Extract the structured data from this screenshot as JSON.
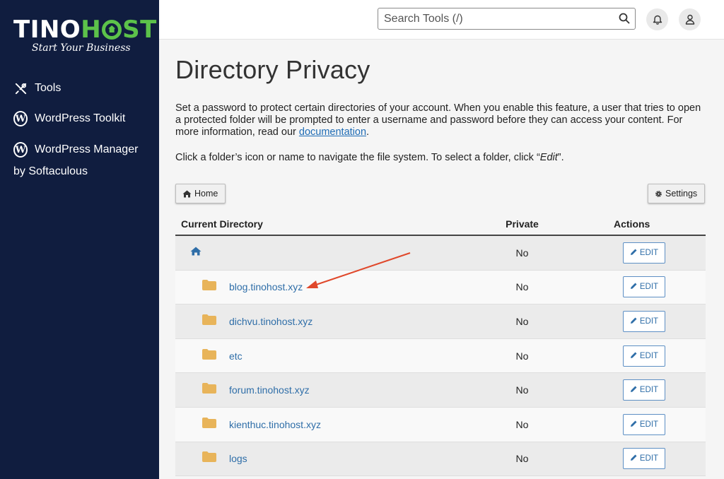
{
  "brand": {
    "logo_text_1": "TINO",
    "logo_text_2": "HOST",
    "tagline": "Start Your Business",
    "accent_green": "#5cc24a",
    "sidebar_bg": "#101d3f"
  },
  "sidebar": {
    "items": [
      {
        "label": "Tools",
        "icon": "tools-icon"
      },
      {
        "label": "WordPress Toolkit",
        "icon": "wordpress-icon"
      },
      {
        "label": "WordPress Manager",
        "icon": "wordpress-icon"
      }
    ],
    "wp_manager_sub": "by Softaculous"
  },
  "topbar": {
    "search_placeholder": "Search Tools (/)",
    "icons": [
      "search-icon",
      "bell-icon",
      "user-icon"
    ]
  },
  "page": {
    "title": "Directory Privacy",
    "desc_part1": "Set a password to protect certain directories of your account. When you enable this feature, a user that tries to open a protected folder will be prompted to enter a username and password before they can access your content. For more information, read our ",
    "desc_link": "documentation",
    "desc_part2": ".",
    "nav_text1": "Click a folder’s icon or name to navigate the file system. To select a folder, click “",
    "nav_edit": "Edit",
    "nav_text2": "”.",
    "home_button": "Home",
    "settings_button": "Settings"
  },
  "table": {
    "headers": {
      "directory": "Current Directory",
      "private": "Private",
      "actions": "Actions"
    },
    "rows": [
      {
        "name": "",
        "is_home": true,
        "private": "No",
        "action": "EDIT"
      },
      {
        "name": "blog.tinohost.xyz",
        "is_home": false,
        "private": "No",
        "action": "EDIT"
      },
      {
        "name": "dichvu.tinohost.xyz",
        "is_home": false,
        "private": "No",
        "action": "EDIT"
      },
      {
        "name": "etc",
        "is_home": false,
        "private": "No",
        "action": "EDIT"
      },
      {
        "name": "forum.tinohost.xyz",
        "is_home": false,
        "private": "No",
        "action": "EDIT"
      },
      {
        "name": "kienthuc.tinohost.xyz",
        "is_home": false,
        "private": "No",
        "action": "EDIT"
      },
      {
        "name": "logs",
        "is_home": false,
        "private": "No",
        "action": "EDIT"
      }
    ],
    "folder_color": "#e8b45a",
    "link_color": "#2f6ea8"
  },
  "annotation": {
    "arrow_color": "#e0482b"
  }
}
